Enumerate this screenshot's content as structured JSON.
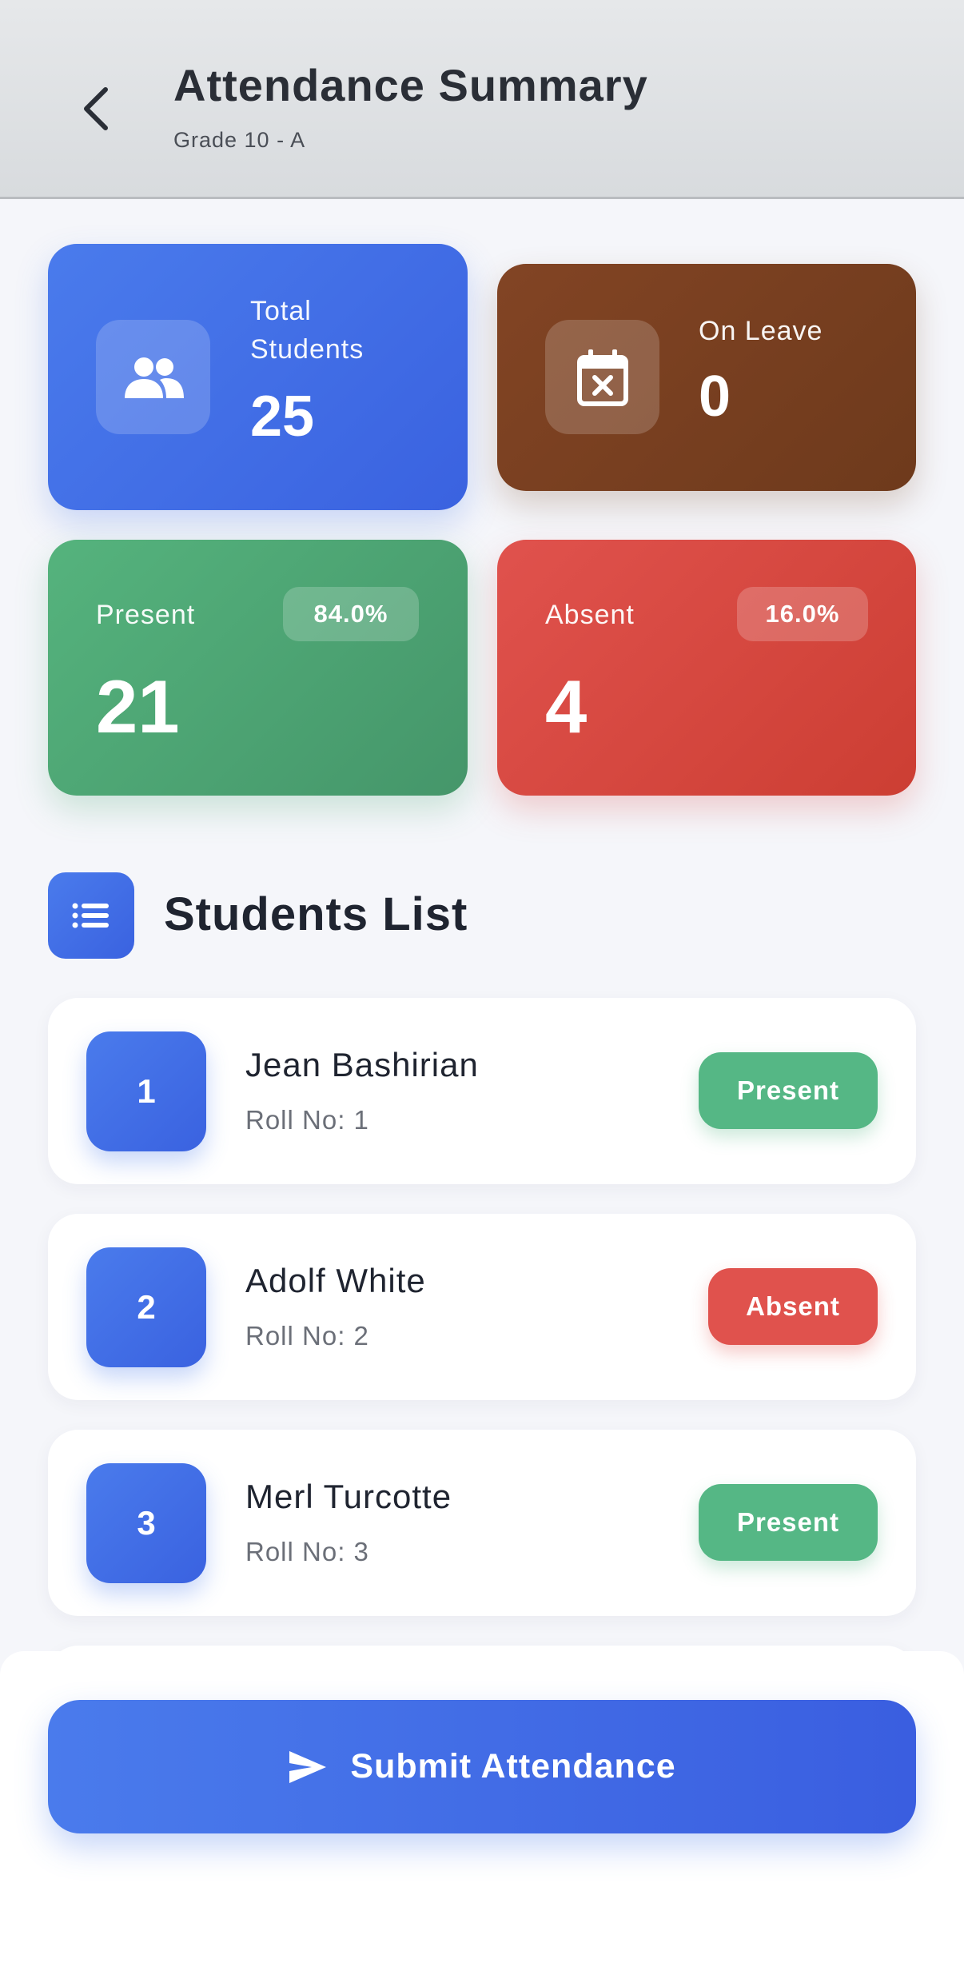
{
  "header": {
    "title": "Attendance Summary",
    "subtitle": "Grade 10 - A",
    "back_icon": "chevron-left-icon"
  },
  "stats": {
    "total": {
      "label": "Total Students",
      "value": "25",
      "icon": "people-icon",
      "color": "#3a62e0"
    },
    "leave": {
      "label": "On Leave",
      "value": "0",
      "icon": "calendar-x-icon",
      "color": "#7a3e1f"
    },
    "present": {
      "label": "Present",
      "value": "21",
      "percent": "84.0%",
      "color": "#4ea674"
    },
    "absent": {
      "label": "Absent",
      "value": "4",
      "percent": "16.0%",
      "color": "#d6463f"
    }
  },
  "students_section": {
    "title": "Students List",
    "icon": "list-icon"
  },
  "students": [
    {
      "number": "1",
      "name": "Jean Bashirian",
      "roll": "Roll No: 1",
      "status": "Present"
    },
    {
      "number": "2",
      "name": "Adolf White",
      "roll": "Roll No: 2",
      "status": "Absent"
    },
    {
      "number": "3",
      "name": "Merl Turcotte",
      "roll": "Roll No: 3",
      "status": "Present"
    }
  ],
  "footer": {
    "submit_label": "Submit Attendance",
    "submit_icon": "send-icon"
  }
}
